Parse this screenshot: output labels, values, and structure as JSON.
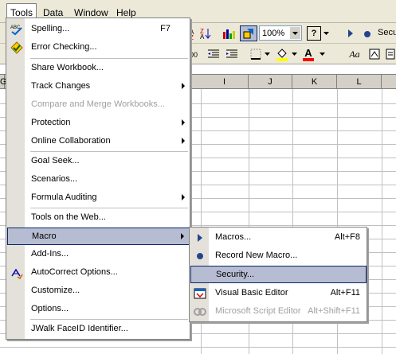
{
  "menubar": {
    "items": [
      {
        "label": "Tools"
      },
      {
        "label": "Data"
      },
      {
        "label": "Window"
      },
      {
        "label": "Help"
      }
    ]
  },
  "toolbar": {
    "zoom": "100%",
    "security_label": "Secu",
    "italic_a": "Aa",
    "font_color": "A"
  },
  "columns": [
    "I",
    "J",
    "K",
    "L"
  ],
  "row_header_fragment": "G",
  "tools_menu": {
    "items": [
      {
        "label": "Spelling...",
        "shortcut": "F7",
        "icon": "spelling-icon"
      },
      {
        "label": "Error Checking...",
        "icon": "error-checking-icon"
      },
      {
        "label": "Share Workbook..."
      },
      {
        "label": "Track Changes"
      },
      {
        "label": "Compare and Merge Workbooks..."
      },
      {
        "label": "Protection"
      },
      {
        "label": "Online Collaboration"
      },
      {
        "label": "Goal Seek..."
      },
      {
        "label": "Scenarios..."
      },
      {
        "label": "Formula Auditing"
      },
      {
        "label": "Tools on the Web..."
      },
      {
        "label": "Macro"
      },
      {
        "label": "Add-Ins..."
      },
      {
        "label": "AutoCorrect Options...",
        "icon": "autocorrect-icon"
      },
      {
        "label": "Customize..."
      },
      {
        "label": "Options..."
      },
      {
        "label": "JWalk FaceID Identifier..."
      }
    ]
  },
  "macro_submenu": {
    "items": [
      {
        "label": "Macros...",
        "shortcut": "Alt+F8"
      },
      {
        "label": "Record New Macro..."
      },
      {
        "label": "Security..."
      },
      {
        "label": "Visual Basic Editor",
        "shortcut": "Alt+F11"
      },
      {
        "label": "Microsoft Script Editor",
        "shortcut": "Alt+Shift+F11"
      }
    ]
  },
  "colors": {
    "highlight": "#b6bdd2",
    "highlight_border": "#0a246a",
    "disabled_text": "#a0a0a0"
  }
}
